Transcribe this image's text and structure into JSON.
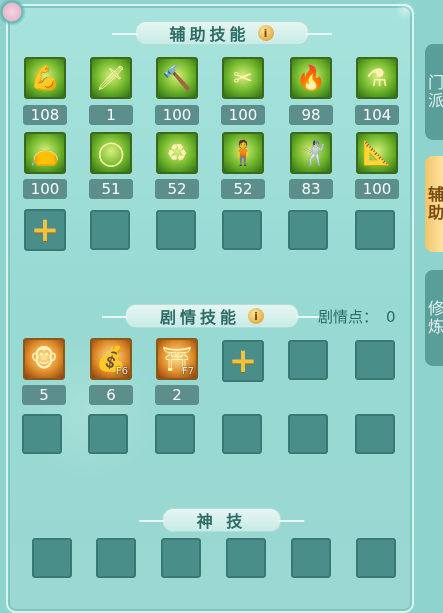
{
  "side_tabs": [
    "门派",
    "辅助",
    "修炼"
  ],
  "assist": {
    "title": "辅助技能",
    "info_icon": "i",
    "row1": [
      {
        "icon": "muscle-icon",
        "glyph": "💪",
        "level": "108",
        "style": "green"
      },
      {
        "icon": "darts-icon",
        "glyph": "🗡",
        "level": "1",
        "style": "green"
      },
      {
        "icon": "anvil-icon",
        "glyph": "🔨",
        "level": "100",
        "style": "green"
      },
      {
        "icon": "scissors-icon",
        "glyph": "✂",
        "level": "100",
        "style": "green"
      },
      {
        "icon": "flame-icon",
        "glyph": "🔥",
        "level": "98",
        "style": "green"
      },
      {
        "icon": "cauldron-icon",
        "glyph": "⚗",
        "level": "104",
        "style": "green"
      }
    ],
    "row2": [
      {
        "icon": "pouch-icon",
        "glyph": "👝",
        "level": "100",
        "style": "green"
      },
      {
        "icon": "ring-icon",
        "glyph": "◯",
        "level": "51",
        "style": "green"
      },
      {
        "icon": "cycle-icon",
        "glyph": "♻",
        "level": "52",
        "style": "green"
      },
      {
        "icon": "warrior-icon",
        "glyph": "🧍",
        "level": "52",
        "style": "green"
      },
      {
        "icon": "strongman-icon",
        "glyph": "🤺",
        "level": "83",
        "style": "green"
      },
      {
        "icon": "compass-icon",
        "glyph": "📐",
        "level": "100",
        "style": "green"
      }
    ]
  },
  "story": {
    "title": "剧情技能",
    "info_icon": "i",
    "points_label": "剧情点：",
    "points_value": "0",
    "skills": [
      {
        "icon": "monkey-icon",
        "glyph": "🐵",
        "level": "5",
        "style": "orange",
        "key": ""
      },
      {
        "icon": "gold-ingot-icon",
        "glyph": "💰",
        "level": "6",
        "style": "orange",
        "key": "F6"
      },
      {
        "icon": "pavilion-icon",
        "glyph": "⛩",
        "level": "2",
        "style": "orange",
        "key": "F7"
      }
    ]
  },
  "divine": {
    "title": "神 技"
  },
  "colors": {
    "accent": "#f3c23e",
    "slot": "#4a8e89",
    "panel": "#9ad8d1"
  }
}
